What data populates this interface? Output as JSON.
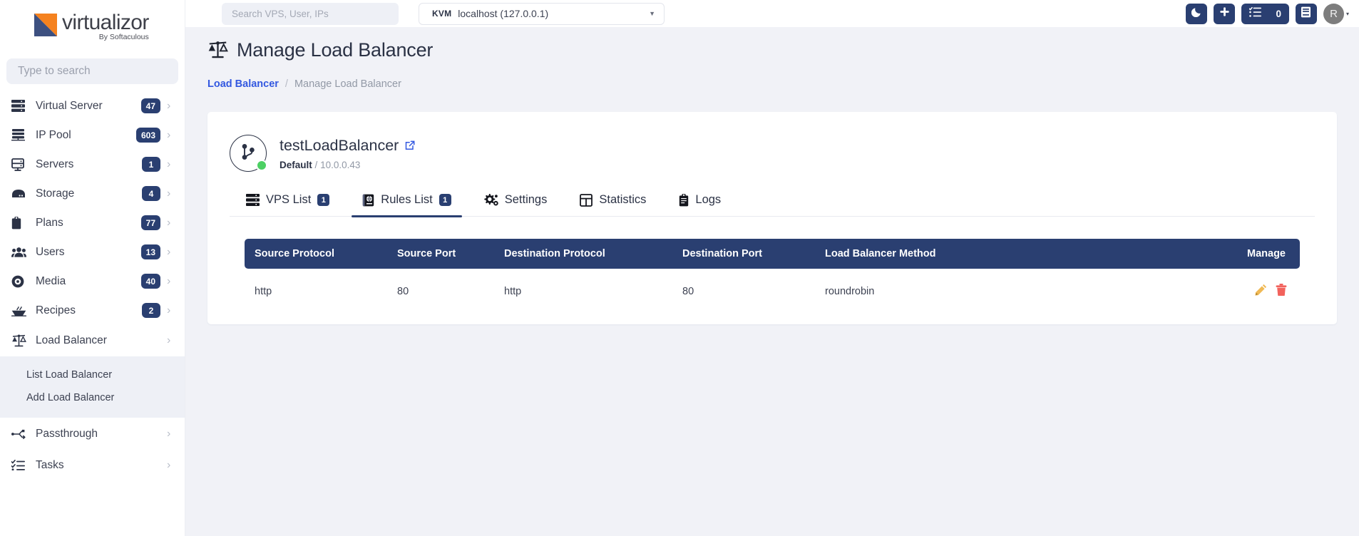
{
  "brand": {
    "name": "virtualizor",
    "tagline": "By Softaculous",
    "orange": "#f5821f",
    "navy": "#3d5080"
  },
  "sidebar": {
    "search_placeholder": "Type to search",
    "items": [
      {
        "label": "Virtual Server",
        "badge": "47",
        "icon": "servers-stack-icon",
        "chevron": "›"
      },
      {
        "label": "IP Pool",
        "badge": "603",
        "icon": "ip-pool-icon",
        "chevron": "›"
      },
      {
        "label": "Servers",
        "badge": "1",
        "icon": "server-icon",
        "chevron": "›"
      },
      {
        "label": "Storage",
        "badge": "4",
        "icon": "storage-icon",
        "chevron": "›"
      },
      {
        "label": "Plans",
        "badge": "77",
        "icon": "clipboard-icon",
        "chevron": "›"
      },
      {
        "label": "Users",
        "badge": "13",
        "icon": "users-icon",
        "chevron": "›"
      },
      {
        "label": "Media",
        "badge": "40",
        "icon": "disc-icon",
        "chevron": "›"
      },
      {
        "label": "Recipes",
        "badge": "2",
        "icon": "recipe-bowl-icon",
        "chevron": "›"
      },
      {
        "label": "Load Balancer",
        "badge": "",
        "icon": "scales-icon",
        "chevron": "›"
      }
    ],
    "submenu": [
      {
        "label": "List Load Balancer"
      },
      {
        "label": "Add Load Balancer"
      }
    ],
    "items_after": [
      {
        "label": "Passthrough",
        "badge": "",
        "icon": "usb-icon",
        "chevron": "›"
      },
      {
        "label": "Tasks",
        "badge": "",
        "icon": "tasks-icon",
        "chevron": "›"
      }
    ]
  },
  "topbar": {
    "search_placeholder": "Search VPS, User, IPs",
    "search_value": "",
    "host": {
      "type": "KVM",
      "name": "localhost (127.0.0.1)",
      "caret": "▼"
    },
    "actions": {
      "dark_mode": "moon-icon",
      "add": "plus-icon",
      "tasks_count": "0",
      "docs": "book-icon",
      "avatar_initial": "R",
      "avatar_caret": "▾"
    }
  },
  "page": {
    "title": "Manage Load Balancer",
    "title_icon": "scales-icon",
    "breadcrumb": {
      "link": "Load Balancer",
      "separator": "/",
      "current": "Manage Load Balancer"
    }
  },
  "loadbalancer": {
    "name": "testLoadBalancer",
    "group": "Default",
    "sub_separator": "/",
    "ip": "10.0.0.43",
    "status_color": "#4cd063",
    "external_link_icon": "external-link-icon"
  },
  "tabs": [
    {
      "label": "VPS List",
      "badge": "1",
      "icon": "servers-stack-icon",
      "active": false
    },
    {
      "label": "Rules List",
      "badge": "1",
      "icon": "rules-globe-icon",
      "active": true
    },
    {
      "label": "Settings",
      "badge": "",
      "icon": "gears-icon",
      "active": false
    },
    {
      "label": "Statistics",
      "badge": "",
      "icon": "grid-table-icon",
      "active": false
    },
    {
      "label": "Logs",
      "badge": "",
      "icon": "clipboard-icon",
      "active": false
    }
  ],
  "rules_table": {
    "columns": [
      "Source Protocol",
      "Source Port",
      "Destination Protocol",
      "Destination Port",
      "Load Balancer Method",
      "Manage"
    ],
    "rows": [
      {
        "source_protocol": "http",
        "source_port": "80",
        "destination_protocol": "http",
        "destination_port": "80",
        "method": "roundrobin",
        "edit_icon": "pencil-icon",
        "delete_icon": "trash-icon"
      }
    ]
  }
}
